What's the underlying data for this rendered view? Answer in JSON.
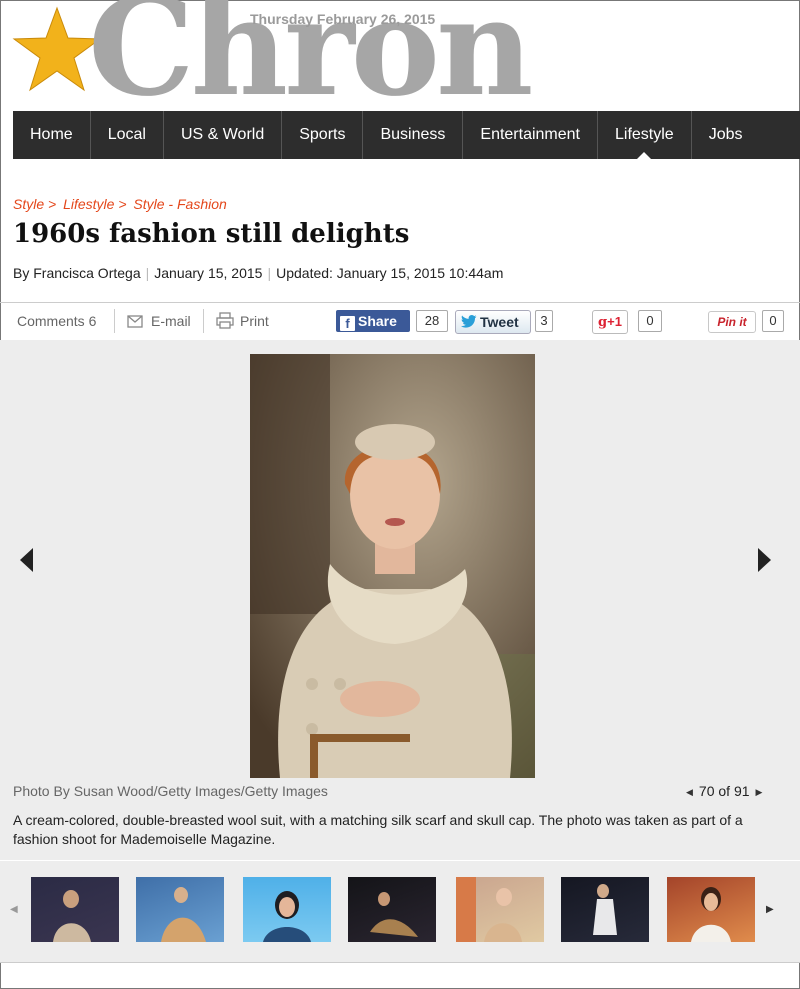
{
  "masthead": {
    "logo": "Chron",
    "date": "Thursday February 26, 2015"
  },
  "nav": [
    "Home",
    "Local",
    "US & World",
    "Sports",
    "Business",
    "Entertainment",
    "Lifestyle",
    "Jobs"
  ],
  "nav_active": "Lifestyle",
  "breadcrumb": [
    "Style >",
    "Lifestyle >",
    "Style - Fashion"
  ],
  "article": {
    "title": "1960s fashion still delights",
    "author": "By Francisca Ortega",
    "date": "January 15, 2015",
    "updated": "Updated: January 15, 2015 10:44am"
  },
  "share": {
    "comments": "Comments 6",
    "email": "E-mail",
    "print": "Print",
    "fb_label": "Share",
    "fb_count": "28",
    "tw_label": "Tweet",
    "tw_count": "3",
    "gplus_label": "+1",
    "gplus_count": "0",
    "pin_label": "Pin it",
    "pin_count": "0"
  },
  "gallery": {
    "credit": "Photo By Susan Wood/Getty Images/Getty Images",
    "counter": "70 of 91",
    "caption": "A cream-colored, double-breasted wool suit, with a matching silk scarf and skull cap. The photo was taken as part of a fashion shoot for Mademoiselle Magazine."
  },
  "colors": {
    "accent": "#e4471b",
    "nav_bg": "#2d2d2d",
    "facebook": "#3b5998"
  }
}
